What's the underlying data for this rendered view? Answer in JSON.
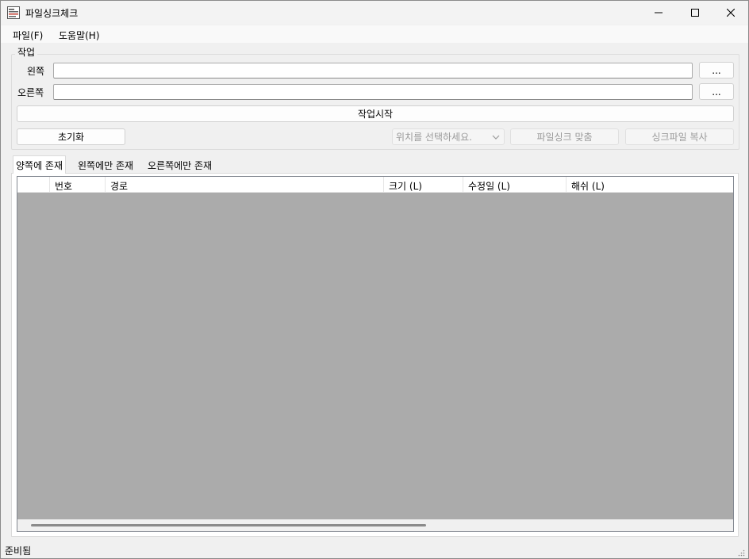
{
  "window": {
    "title": "파일싱크체크"
  },
  "menu": {
    "file": "파일(F)",
    "help": "도움말(H)"
  },
  "group": {
    "title": "작업",
    "left_label": "왼쪽",
    "right_label": "오른쪽",
    "left_value": "",
    "right_value": "",
    "browse_label": "...",
    "start_label": "작업시작",
    "reset_label": "초기화",
    "location_select": "위치를 선택하세요.",
    "sync_match_label": "파일싱크 맞춤",
    "sync_copy_label": "싱크파일 복사"
  },
  "tabs": [
    "양쪽에 존재",
    "왼쪽에만 존재",
    "오른쪽에만 존재"
  ],
  "table": {
    "columns": [
      "",
      "번호",
      "경로",
      "크기 (L)",
      "수정일 (L)",
      "해쉬 (L)"
    ],
    "rows": []
  },
  "status": {
    "text": "준비됨"
  },
  "icons": {
    "app": "app-icon",
    "minimize": "minimize-icon",
    "maximize": "maximize-icon",
    "close": "close-icon",
    "dropdown": "chevron-down-icon",
    "grip": "resize-grip-icon"
  },
  "colors": {
    "list_background": "#ababab",
    "window_background": "#f0f0f0"
  }
}
